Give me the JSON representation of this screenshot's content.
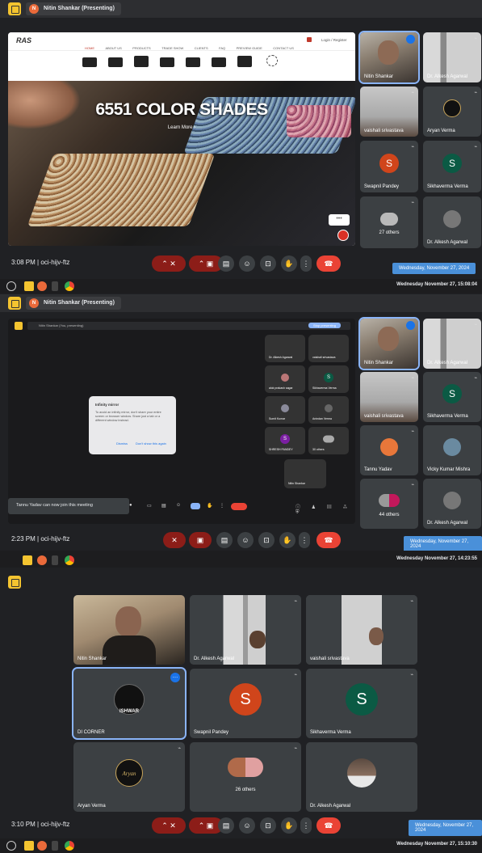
{
  "panel1": {
    "tab_title": "Nitin Shankar (Presenting)",
    "site": {
      "logo": "RAS",
      "nav": [
        "HOME",
        "ABOUT US",
        "PRODUCTS",
        "TRADE SHOW",
        "CLIENTS",
        "FAQ",
        "PREVIEW GUIDE",
        "CONTACT US"
      ],
      "login": "Login / Register",
      "headline": "6551 COLOR SHADES",
      "cta": "Learn More"
    },
    "tiles": [
      {
        "name": "Nitin Shankar"
      },
      {
        "name": "Dr. Alkesh Agarwal"
      },
      {
        "name": "vaishali srivastava"
      },
      {
        "name": "Aryan Verma"
      },
      {
        "name": "Swapnil Pandey",
        "initial": "S",
        "color": "#d0451b"
      },
      {
        "name": "Sikhaverma Verma",
        "initial": "S",
        "color": "#0b5a44"
      },
      {
        "name": "27 others"
      },
      {
        "name": "Dr. Alkesh Agarwal"
      }
    ],
    "time_code": "3:08 PM | oci-hijv-ftz",
    "tooltip": "Wednesday, November 27, 2024",
    "clock": "Wednesday November 27, 15:08:04"
  },
  "panel2": {
    "tab_title": "Nitin Shankar (Presenting)",
    "inner_bar": "Nitin Shankar (You, presenting)",
    "stop_button": "Stop presenting",
    "dialog": {
      "title": "Infinity mirror",
      "body": "To avoid an infinity mirror, don't share your entire screen or browser window. Share just a tab or a different window instead.",
      "dismiss": "Dismiss",
      "dont_show": "Don't show this again"
    },
    "inner_tiles": [
      {
        "name": "Dr. Alkesh Agarwal"
      },
      {
        "name": "vaishali srivastava"
      },
      {
        "name": "alok prakash sagar"
      },
      {
        "name": "Sikhaverma Verma",
        "initial": "S",
        "color": "#0b5a44"
      },
      {
        "name": "Sumit Kumar"
      },
      {
        "name": "Anindan Verma"
      },
      {
        "name": "SHRESH PANDEY",
        "initial": "S",
        "color": "#7b1fa2"
      },
      {
        "name": "30 others"
      },
      {
        "name": "Nitin Shankar"
      }
    ],
    "notification": "Tannu Yadav can now join this meeting",
    "tiles": [
      {
        "name": "Nitin Shankar"
      },
      {
        "name": "Dr. Alkesh Agarwal"
      },
      {
        "name": "vaishali srivastava"
      },
      {
        "name": "Sikhaverma Verma",
        "initial": "S",
        "color": "#0b5a44"
      },
      {
        "name": "Tannu Yadav"
      },
      {
        "name": "Vicky Kumar Mishra"
      },
      {
        "name": "44 others"
      },
      {
        "name": "Dr. Alkesh Agarwal"
      }
    ],
    "time_code": "2:23 PM | oci-hijv-ftz",
    "tooltip": "Wednesday, November 27, 2024",
    "clock": "Wednesday November 27, 14:23:55"
  },
  "panel3": {
    "tiles": [
      {
        "name": "Nitin Shankar"
      },
      {
        "name": "Dr. Alkesh Agarwal"
      },
      {
        "name": "vaishali srivastava"
      },
      {
        "name": "DI CORNER",
        "logo": "ISHWAR"
      },
      {
        "name": "Swapnil Pandey",
        "initial": "S",
        "color": "#d0451b"
      },
      {
        "name": "Sikhaverma Verma",
        "initial": "S",
        "color": "#0b5a44"
      },
      {
        "name": "Aryan Verma",
        "logo": "Aryan"
      },
      {
        "name": "26 others"
      },
      {
        "name": "Dr. Alkesh Agarwal"
      }
    ],
    "time_code": "3:10 PM | oci-hijv-ftz",
    "tooltip": "Wednesday, November 27, 2024",
    "clock": "Wednesday November 27, 15:10:30"
  },
  "icons": {
    "mic": "mic-off-icon",
    "camera": "camera-off-icon",
    "captions": "captions-icon",
    "emoji": "emoji-icon",
    "present": "present-icon",
    "hand": "raise-hand-icon",
    "more": "more-options-icon",
    "leave": "leave-call-icon"
  }
}
